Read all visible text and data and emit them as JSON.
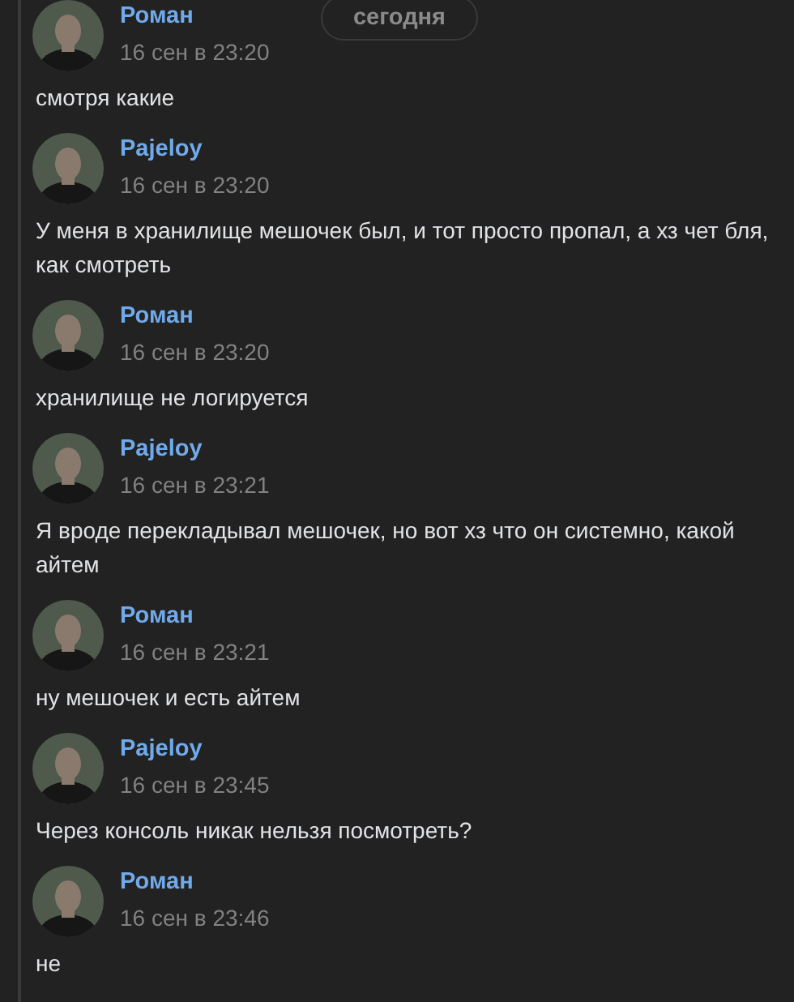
{
  "date_badge": "сегодня",
  "messages": [
    {
      "author": "Роман",
      "time": "16 сен в 23:20",
      "text": "смотря какие"
    },
    {
      "author": "Pajeloy",
      "time": "16 сен в 23:20",
      "text": "У меня в хранилище мешочек был, и тот просто пропал, а хз чет бля, как смотреть"
    },
    {
      "author": "Роман",
      "time": "16 сен в 23:20",
      "text": "хранилище не логируется"
    },
    {
      "author": "Pajeloy",
      "time": "16 сен в 23:21",
      "text": "Я вроде перекладывал мешочек, но вот хз что он системно, какой айтем"
    },
    {
      "author": "Роман",
      "time": "16 сен в 23:21",
      "text": "ну мешочек и есть айтем"
    },
    {
      "author": "Pajeloy",
      "time": "16 сен в 23:45",
      "text": "Через консоль никак нельзя посмотреть?"
    },
    {
      "author": "Роман",
      "time": "16 сен в 23:46",
      "text": "не"
    }
  ]
}
